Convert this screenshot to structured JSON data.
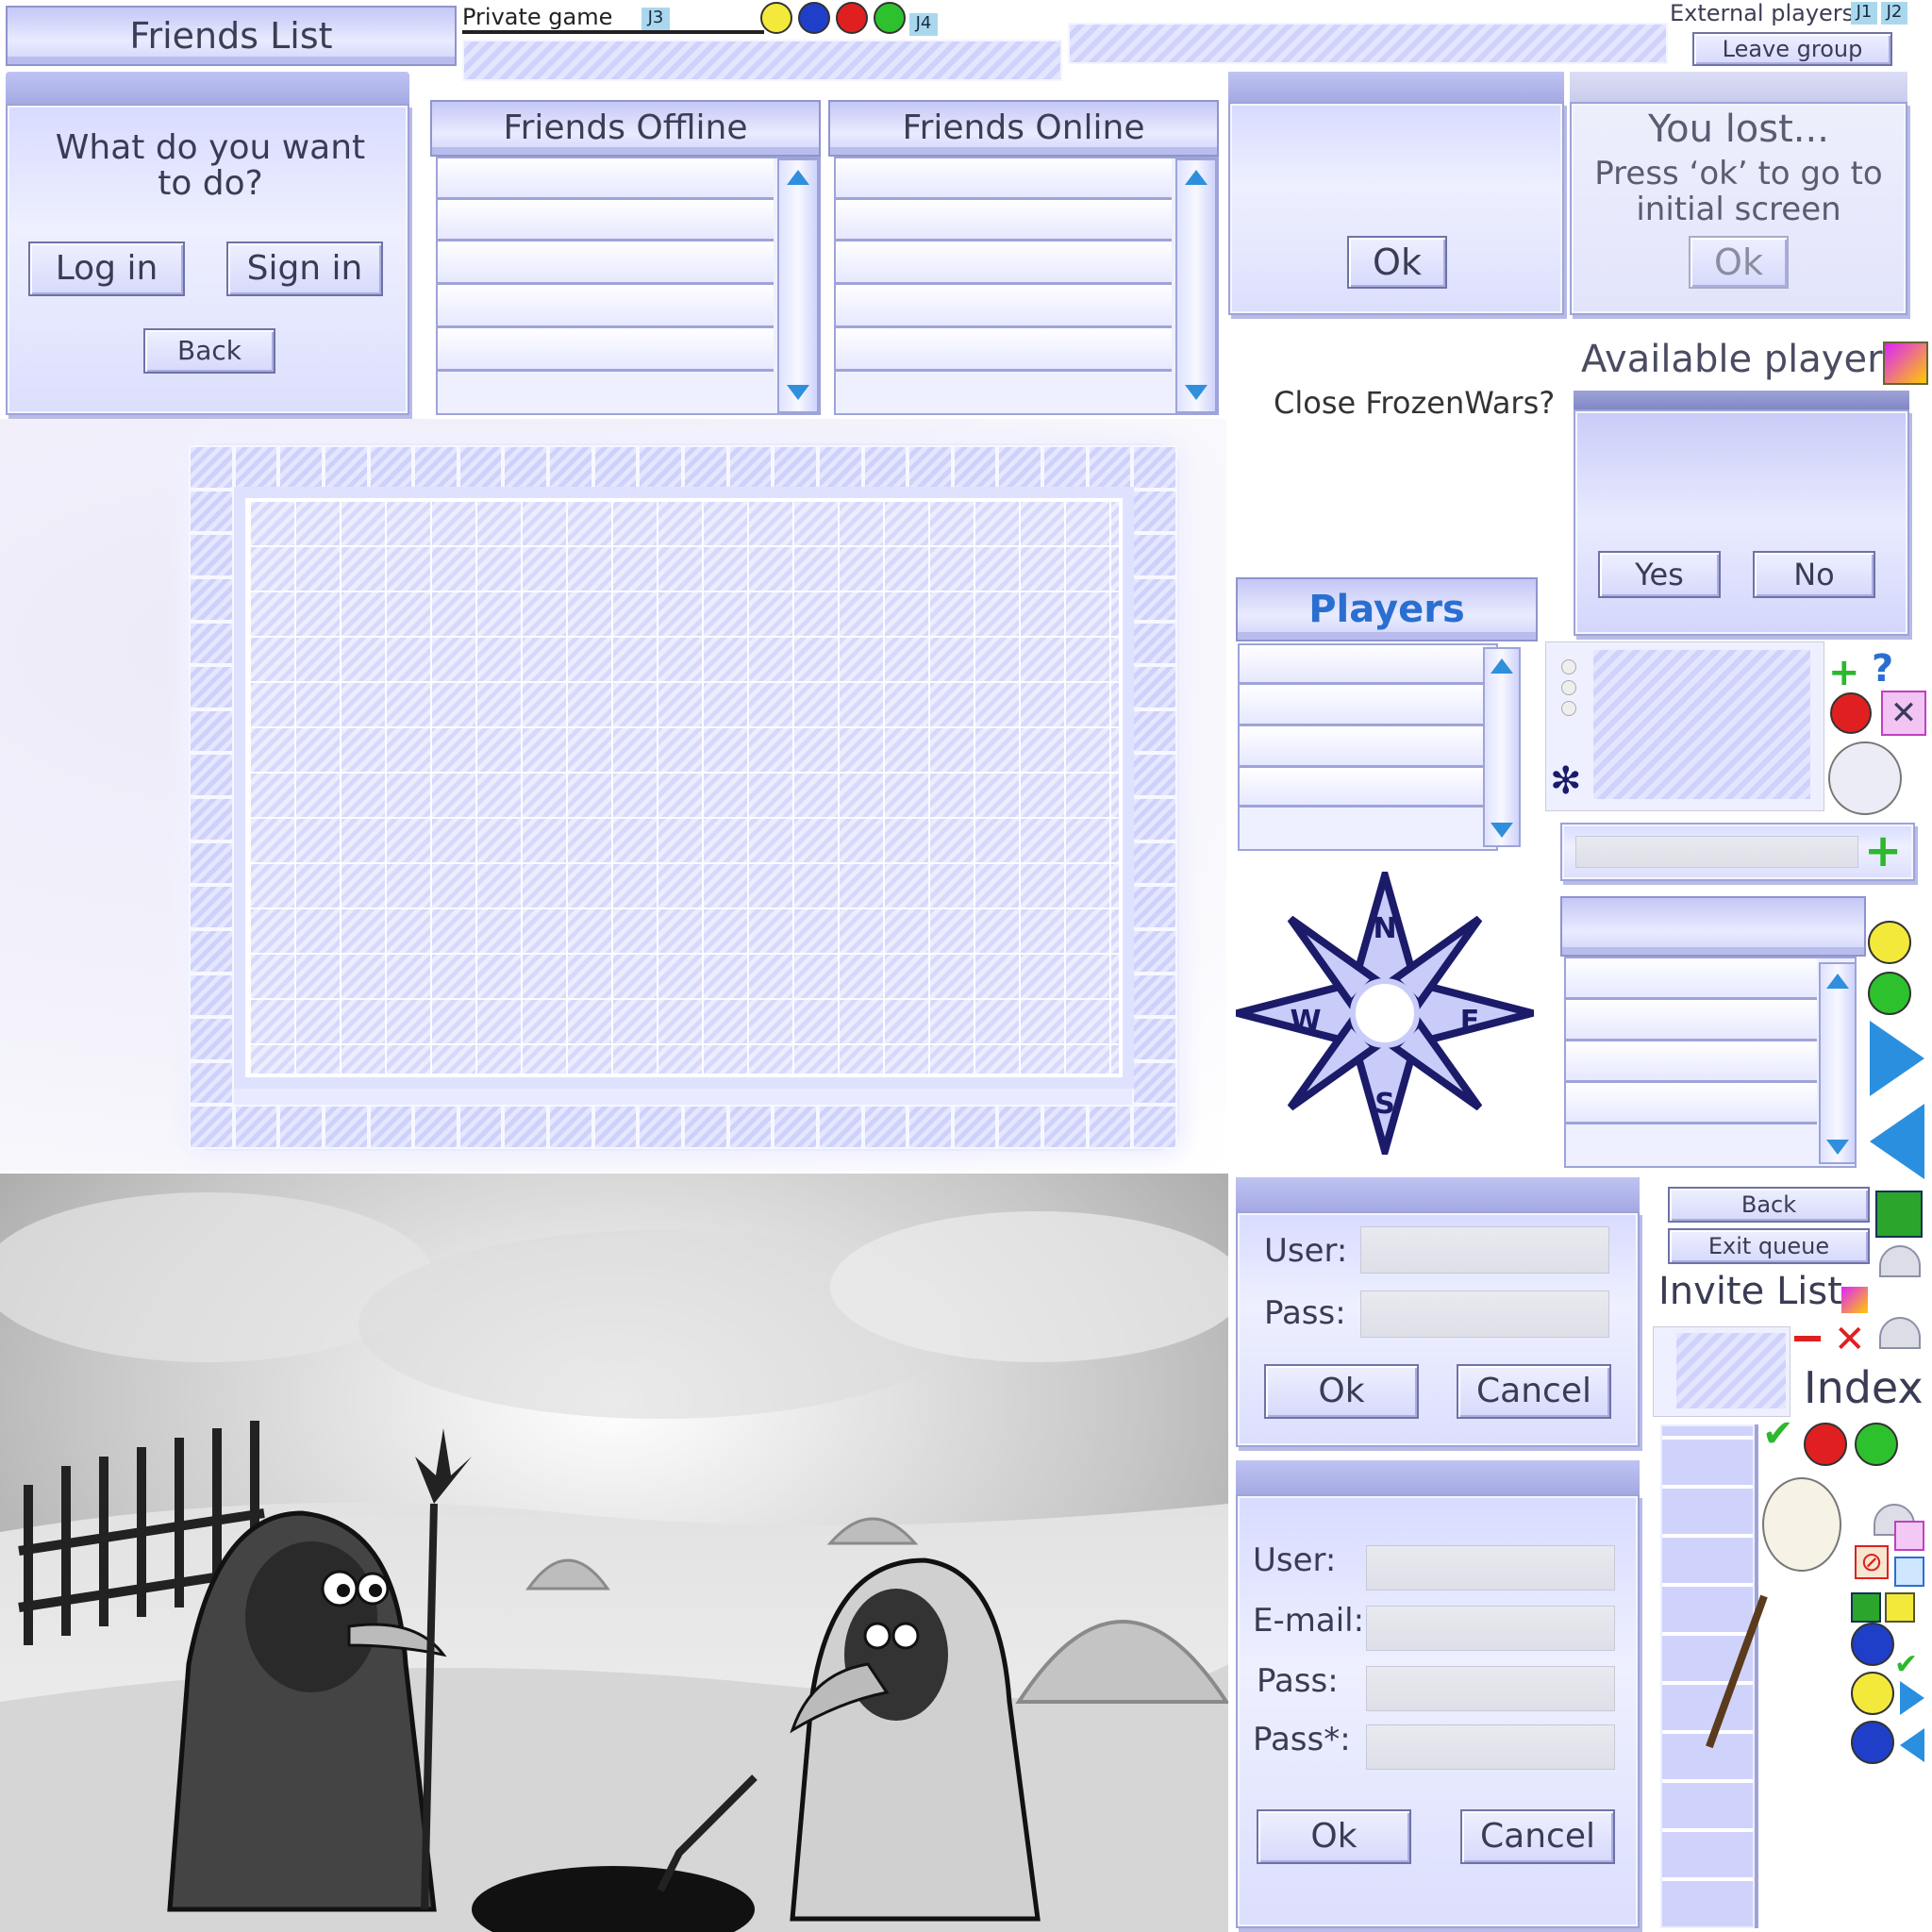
{
  "friends_list": {
    "title": "Friends List"
  },
  "topbar": {
    "private_game": "Private game",
    "j3": "J3",
    "j4": "J4"
  },
  "external": {
    "title": "External players",
    "j1": "J1",
    "j2": "J2",
    "leave_group": "Leave group"
  },
  "login_choice": {
    "prompt": "What do you want to do?",
    "login": "Log in",
    "signin": "Sign in",
    "back": "Back"
  },
  "friends_offline": {
    "title": "Friends Offline"
  },
  "friends_online": {
    "title": "Friends Online"
  },
  "ok_dialog": {
    "ok": "Ok"
  },
  "lost_dialog": {
    "line1": "You lost...",
    "line2": "Press ‘ok’ to go to",
    "line3": "initial screen",
    "ok": "Ok"
  },
  "close_prompt": "Close FrozenWars?",
  "available": {
    "title": "Available players",
    "yes": "Yes",
    "no": "No"
  },
  "players": {
    "title": "Players"
  },
  "compass": {
    "n": "N",
    "e": "E",
    "s": "S",
    "w": "W"
  },
  "login_form": {
    "user": "User:",
    "pass": "Pass:",
    "ok": "Ok",
    "cancel": "Cancel"
  },
  "register_form": {
    "user": "User:",
    "email": "E-mail:",
    "pass": "Pass:",
    "pass_confirm": "Pass*:",
    "ok": "Ok",
    "cancel": "Cancel"
  },
  "side_menu": {
    "back": "Back",
    "exit_queue": "Exit queue",
    "invite_list": "Invite List",
    "index": "Index"
  },
  "colors": {
    "ice_blue": "#d8dbff",
    "accent_blue": "#2f8fdc",
    "border": "#9ea3d8"
  }
}
